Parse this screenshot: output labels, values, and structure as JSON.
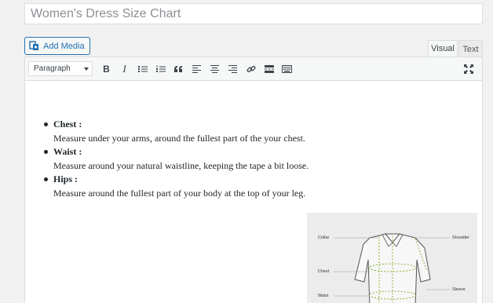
{
  "post": {
    "title_value": "Women's Dress Size Chart"
  },
  "media": {
    "add_media_label": "Add Media"
  },
  "editor": {
    "tabs": [
      {
        "label": "Visual",
        "active": true
      },
      {
        "label": "Text",
        "active": false
      }
    ],
    "format_select_value": "Paragraph",
    "toolbar_icons": [
      "bold-icon",
      "italic-icon",
      "bulleted-list-icon",
      "numbered-list-icon",
      "blockquote-icon",
      "align-left-icon",
      "align-center-icon",
      "align-right-icon",
      "link-icon",
      "read-more-icon",
      "toolbar-toggle-icon",
      "fullscreen-icon"
    ],
    "bold_glyph": "B",
    "italic_glyph": "I"
  },
  "content": {
    "items": [
      {
        "term": "Chest :",
        "desc": "Measure under your arms, around the fullest part of the your chest."
      },
      {
        "term": "Waist :",
        "desc": "Measure around your natural waistline, keeping the tape a bit loose."
      },
      {
        "term": "Hips :",
        "desc": "Measure around the fullest part of your body at the top of your leg."
      }
    ],
    "image_labels": {
      "collar": "Collar",
      "shoulder": "Shoulder",
      "chest": "Chest",
      "sleeve": "Sleeve",
      "waist": "Waist"
    }
  },
  "colors": {
    "accent": "#2271b1",
    "measure_line": "#8db33a"
  }
}
